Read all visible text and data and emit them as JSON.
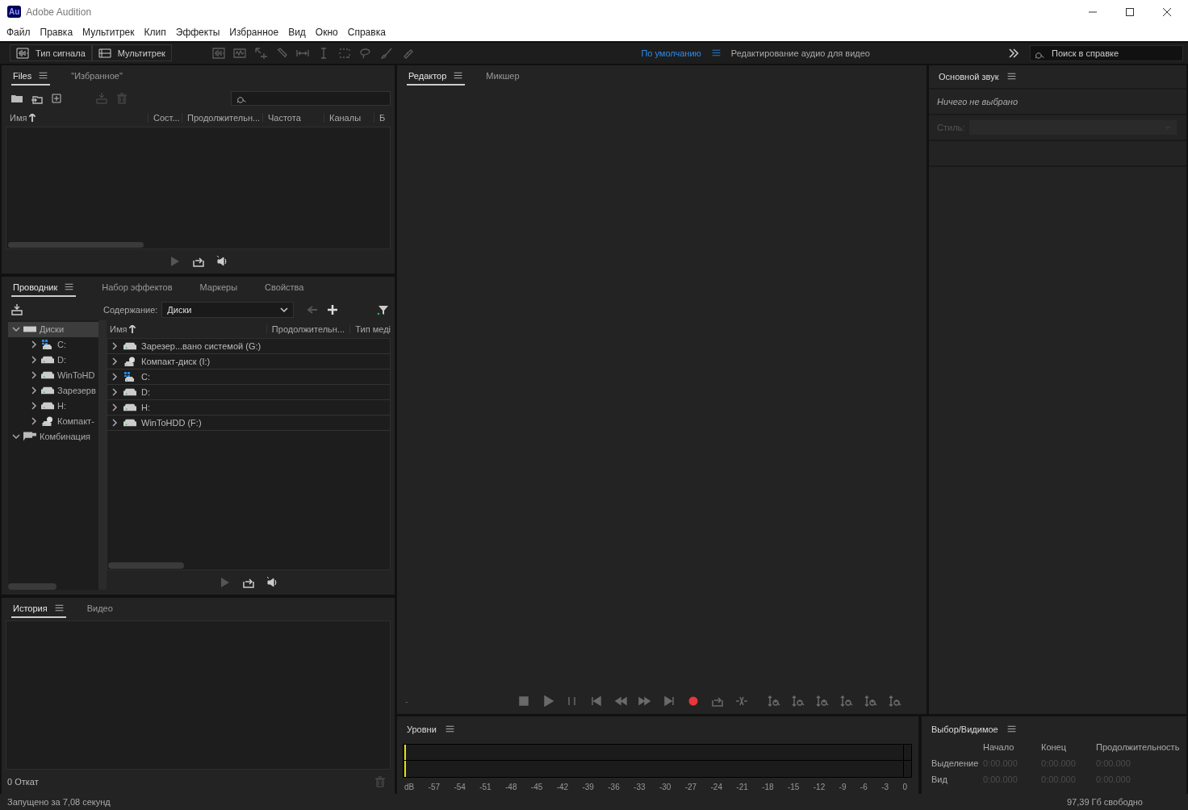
{
  "window": {
    "title": "Adobe Audition",
    "logo": "Au"
  },
  "menu": [
    "Файл",
    "Правка",
    "Мультитрек",
    "Клип",
    "Эффекты",
    "Избранное",
    "Вид",
    "Окно",
    "Справка"
  ],
  "toolbar": {
    "modes": [
      {
        "label": "Тип сигнала",
        "kind": "waveform"
      },
      {
        "label": "Мультитрек",
        "kind": "multitrack"
      }
    ],
    "workspaces": [
      {
        "label": "По умолчанию",
        "selected": true
      },
      {
        "label": "Редактирование аудио для видео",
        "selected": false
      }
    ],
    "search": {
      "placeholder": "Поиск в справке"
    }
  },
  "files_panel": {
    "tabs": [
      {
        "label": "Files",
        "selected": true
      },
      {
        "label": "\"Избранное\"",
        "selected": false
      }
    ],
    "columns": [
      "Имя",
      "Сост...",
      "Продолжительн...",
      "Частота",
      "Каналы",
      "Б"
    ]
  },
  "explorer": {
    "tabs": [
      {
        "label": "Проводник",
        "selected": true
      },
      {
        "label": "Набор эффектов",
        "selected": false
      },
      {
        "label": "Маркеры",
        "selected": false
      },
      {
        "label": "Свойства",
        "selected": false
      }
    ],
    "content_label": "Содержание:",
    "content_value": "Диски",
    "tree": [
      {
        "label": "Диски",
        "kind": "folder",
        "expanded": true,
        "selected": true,
        "children": [
          {
            "label": "C:",
            "kind": "system",
            "expanded": false,
            "selected": false
          },
          {
            "label": "D:",
            "kind": "disk",
            "expanded": false,
            "selected": false
          },
          {
            "label": "WinToHD",
            "kind": "disk",
            "expanded": false,
            "selected": false
          },
          {
            "label": "Зарезерв",
            "kind": "disk",
            "expanded": false,
            "selected": false
          },
          {
            "label": "H:",
            "kind": "disk",
            "expanded": false,
            "selected": false
          },
          {
            "label": "Компакт-",
            "kind": "cd",
            "expanded": false,
            "selected": false
          }
        ]
      },
      {
        "label": "Комбинация",
        "kind": "shortcut",
        "expanded": true,
        "selected": false
      }
    ],
    "columns": [
      "Имя",
      "Продолжительн...",
      "Тип меді"
    ],
    "rows": [
      {
        "name": "Зарезер...вано системой (G:)",
        "kind": "disk"
      },
      {
        "name": "Компакт-диск (I:)",
        "kind": "cd"
      },
      {
        "name": "C:",
        "kind": "system"
      },
      {
        "name": "D:",
        "kind": "disk"
      },
      {
        "name": "H:",
        "kind": "disk"
      },
      {
        "name": "WinToHDD (F:)",
        "kind": "disk"
      }
    ]
  },
  "history_panel": {
    "tabs": [
      {
        "label": "История",
        "selected": true
      },
      {
        "label": "Видео",
        "selected": false
      }
    ],
    "undo_count": "0 Откат"
  },
  "editor_panel": {
    "tabs": [
      {
        "label": "Редактор",
        "selected": true
      },
      {
        "label": "Микшер",
        "selected": false
      }
    ],
    "time": "-"
  },
  "levels_panel": {
    "title": "Уровни",
    "scale": [
      "dB",
      "-57",
      "-54",
      "-51",
      "-48",
      "-45",
      "-42",
      "-39",
      "-36",
      "-33",
      "-30",
      "-27",
      "-24",
      "-21",
      "-18",
      "-15",
      "-12",
      "-9",
      "-6",
      "-3",
      "0"
    ]
  },
  "selection_panel": {
    "title": "Выбор/Видимое",
    "columns": [
      "Начало",
      "Конец",
      "Продолжительность"
    ],
    "rows": [
      {
        "label": "Выделение",
        "values": [
          "0:00.000",
          "0:00.000",
          "0:00.000"
        ]
      },
      {
        "label": "Вид",
        "values": [
          "0:00.000",
          "0:00.000",
          "0:00.000"
        ]
      }
    ]
  },
  "essential_sound": {
    "title": "Основной звук",
    "status": "Ничего не выбрано",
    "style_label": "Стиль:"
  },
  "status_bar": {
    "message": "Запущено за 7,08 секунд",
    "free_space": "97,39 Гб свободно"
  }
}
